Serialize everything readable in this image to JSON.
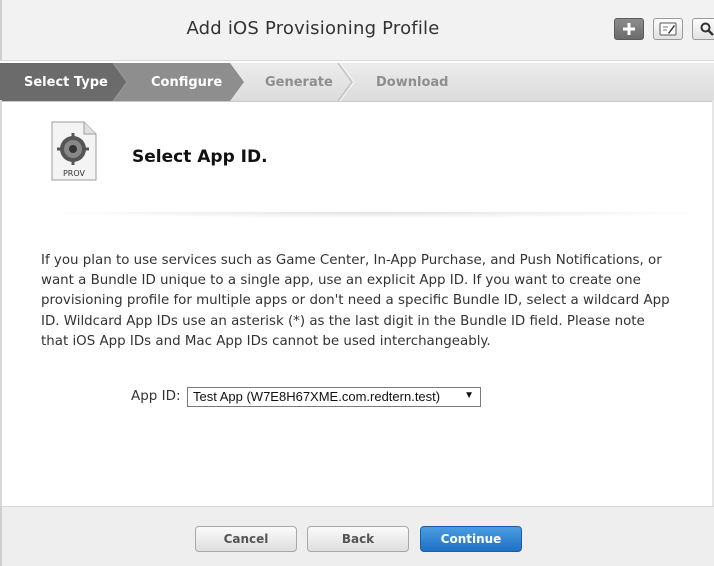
{
  "header": {
    "title": "Add iOS Provisioning Profile",
    "buttons": [
      {
        "name": "plus-icon"
      },
      {
        "name": "edit-icon"
      },
      {
        "name": "search-icon"
      }
    ]
  },
  "steps": [
    {
      "label": "Select Type",
      "state": "done"
    },
    {
      "label": "Configure",
      "state": "current"
    },
    {
      "label": "Generate",
      "state": "todo"
    },
    {
      "label": "Download",
      "state": "todo"
    }
  ],
  "section": {
    "icon_label": "PROV",
    "title": "Select App ID."
  },
  "description": "If you plan to use services such as Game Center, In-App Purchase, and Push Notifications, or want a Bundle ID unique to a single app, use an explicit App ID. If you want to create one provisioning profile for multiple apps or don't need a specific Bundle ID, select a wildcard App ID. Wildcard App IDs use an asterisk (*) as the last digit in the Bundle ID field. Please note that iOS App IDs and Mac App IDs cannot be used interchangeably.",
  "form": {
    "app_id_label": "App ID:",
    "app_id_value": "Test App (W7E8H67XME.com.redtern.test)"
  },
  "footer": {
    "cancel_label": "Cancel",
    "back_label": "Back",
    "continue_label": "Continue"
  },
  "colors": {
    "step_done": "#6a6a6a",
    "step_current": "#8c8c8c",
    "primary": "#2a7fd4"
  }
}
